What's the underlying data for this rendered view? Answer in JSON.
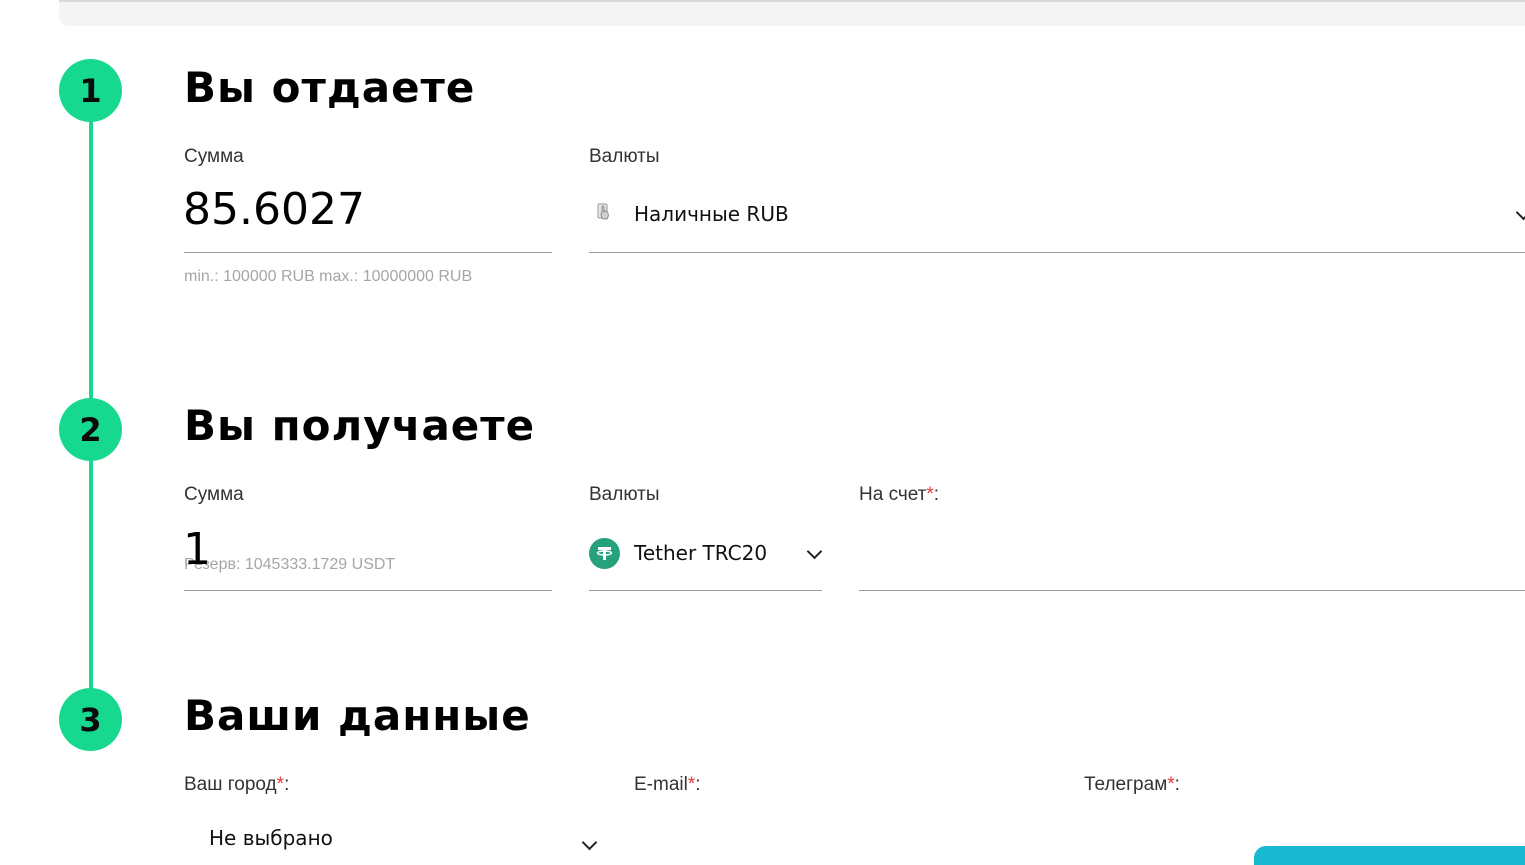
{
  "step1": {
    "number": "1",
    "title": "Вы отдаете",
    "amount_label": "Сумма",
    "amount_value": "85.6027",
    "limits": "min.: 100000 RUB   max.: 10000000 RUB",
    "currency_label": "Валюты",
    "currency_value": "Наличные RUB",
    "currency_icon": "cash-icon"
  },
  "step2": {
    "number": "2",
    "title": "Вы получаете",
    "amount_label": "Сумма",
    "amount_value": "1",
    "reserve": "Резерв: 1045333.1729 USDT",
    "currency_label": "Валюты",
    "currency_value": "Tether TRC20",
    "currency_icon": "tether-icon",
    "account_label": "На счет",
    "account_required": "*",
    "account_suffix": ":"
  },
  "step3": {
    "number": "3",
    "title": "Ваши данные",
    "city_label": "Ваш город",
    "city_required": "*",
    "city_suffix": ":",
    "city_value": "Не выбрано",
    "email_label": "E-mail",
    "email_required": "*",
    "email_suffix": ":",
    "telegram_label": "Телеграм",
    "telegram_required": "*",
    "telegram_suffix": ":"
  },
  "colors": {
    "accent": "#16d98f",
    "tether": "#26a17b",
    "required": "#e23b3b",
    "button": "#17b8d0"
  }
}
